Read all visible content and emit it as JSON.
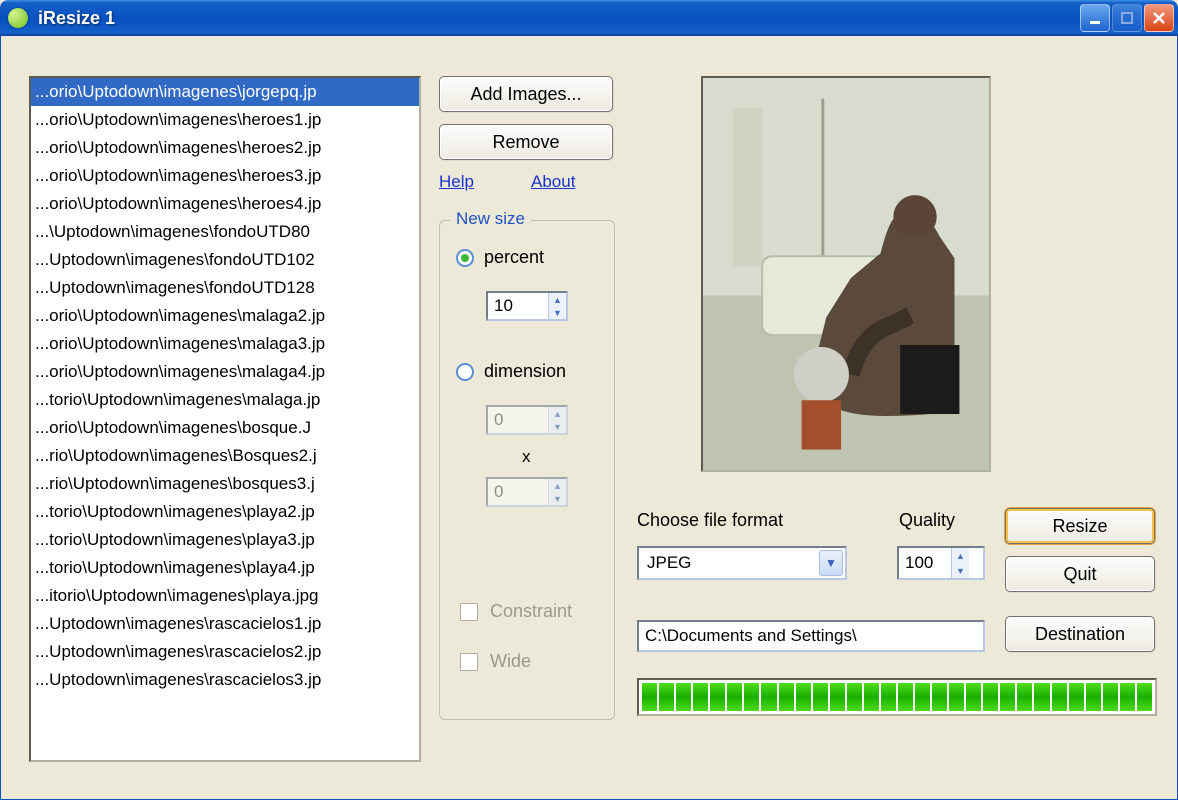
{
  "window": {
    "title": "iResize 1"
  },
  "list": {
    "items": [
      "...orio\\Uptodown\\imagenes\\jorgepq.jp",
      "...orio\\Uptodown\\imagenes\\heroes1.jp",
      "...orio\\Uptodown\\imagenes\\heroes2.jp",
      "...orio\\Uptodown\\imagenes\\heroes3.jp",
      "...orio\\Uptodown\\imagenes\\heroes4.jp",
      "...\\Uptodown\\imagenes\\fondoUTD80",
      "...Uptodown\\imagenes\\fondoUTD102",
      "...Uptodown\\imagenes\\fondoUTD128",
      "...orio\\Uptodown\\imagenes\\malaga2.jp",
      "...orio\\Uptodown\\imagenes\\malaga3.jp",
      "...orio\\Uptodown\\imagenes\\malaga4.jp",
      "...torio\\Uptodown\\imagenes\\malaga.jp",
      "...orio\\Uptodown\\imagenes\\bosque.J",
      "...rio\\Uptodown\\imagenes\\Bosques2.j",
      "...rio\\Uptodown\\imagenes\\bosques3.j",
      "...torio\\Uptodown\\imagenes\\playa2.jp",
      "...torio\\Uptodown\\imagenes\\playa3.jp",
      "...torio\\Uptodown\\imagenes\\playa4.jp",
      "...itorio\\Uptodown\\imagenes\\playa.jpg",
      "...Uptodown\\imagenes\\rascacielos1.jp",
      "...Uptodown\\imagenes\\rascacielos2.jp",
      "...Uptodown\\imagenes\\rascacielos3.jp"
    ],
    "selected_index": 0
  },
  "buttons": {
    "add": "Add Images...",
    "remove": "Remove",
    "resize": "Resize",
    "quit": "Quit",
    "destination": "Destination"
  },
  "links": {
    "help": "Help",
    "about": "About"
  },
  "new_size": {
    "legend": "New size",
    "percent_label": "percent",
    "percent_value": "10",
    "dimension_label": "dimension",
    "dim_w": "0",
    "dim_h": "0",
    "dim_separator": "x",
    "constraint_label": "Constraint",
    "wide_label": "Wide",
    "selected": "percent"
  },
  "format": {
    "label": "Choose file format",
    "value": "JPEG"
  },
  "quality": {
    "label": "Quality",
    "value": "100"
  },
  "destination": {
    "path": "C:\\Documents and Settings\\"
  },
  "progress": {
    "segments": 30,
    "filled": 30
  },
  "icons": {
    "app": "iresize-icon",
    "minimize": "minimize-icon",
    "maximize": "maximize-icon",
    "close": "close-icon",
    "chevron_down": "chevron-down-icon",
    "spin_up": "spin-up-icon",
    "spin_down": "spin-down-icon"
  }
}
